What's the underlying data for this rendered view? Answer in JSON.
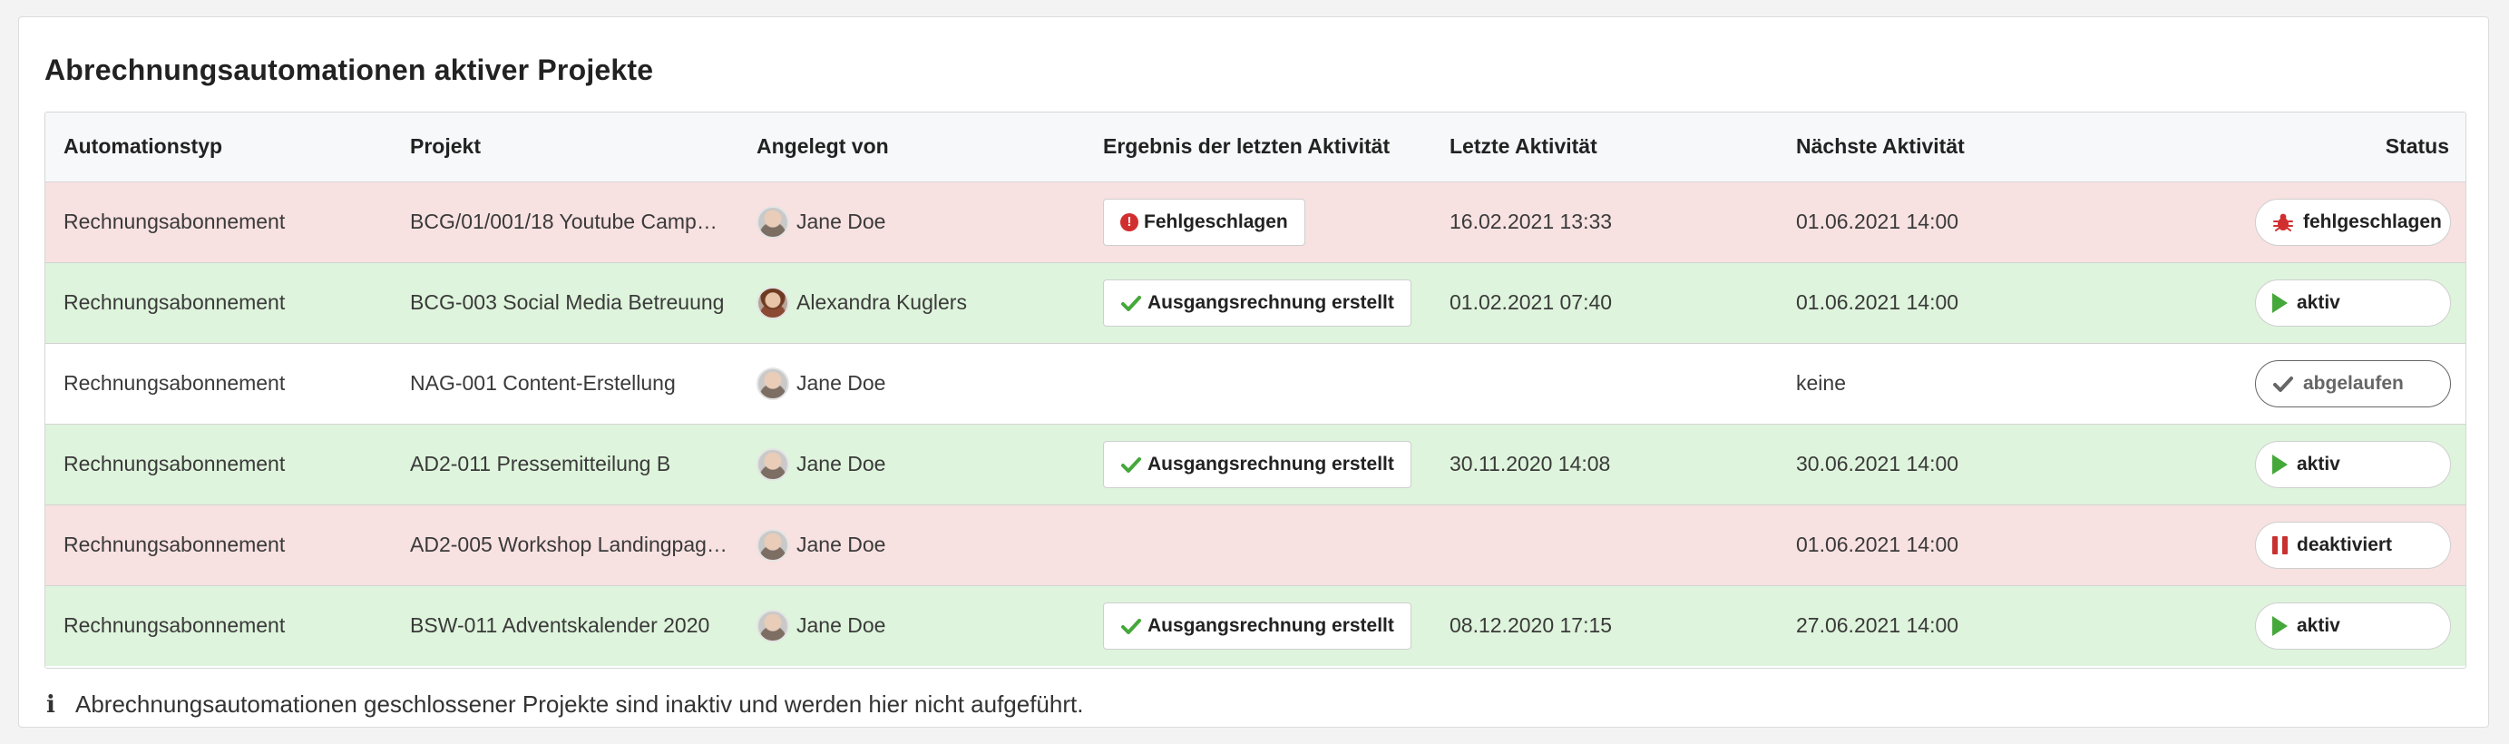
{
  "panel": {
    "title": "Abrechnungsautomationen aktiver Projekte",
    "footer_note": "Abrechnungsautomationen geschlossener Projekte sind inaktiv und werden hier nicht aufgeführt.",
    "footer_icon": "info-icon"
  },
  "table": {
    "headers": {
      "type": "Automationstyp",
      "project": "Projekt",
      "creator": "Angelegt von",
      "result": "Ergebnis der letzten Aktivität",
      "last": "Letzte Aktivität",
      "next": "Nächste Aktivität",
      "status": "Status"
    },
    "rows": [
      {
        "tone": "red",
        "type": "Rechnungsabonnement",
        "project": "BCG/01/001/18 Youtube Camp…",
        "creator": "Jane Doe",
        "result": "Fehlgeschlagen",
        "result_icon": "error-icon",
        "last": "16.02.2021 13:33",
        "next": "01.06.2021 14:00",
        "status": "fehlgeschlagen",
        "status_icon": "bug-icon"
      },
      {
        "tone": "green",
        "type": "Rechnungsabonnement",
        "project": "BCG-003 Social Media Betreuung",
        "creator": "Alexandra Kuglers",
        "result": "Ausgangsrechnung erstellt",
        "result_icon": "check-icon",
        "last": "01.02.2021 07:40",
        "next": "01.06.2021 14:00",
        "status": "aktiv",
        "status_icon": "play-icon"
      },
      {
        "tone": "white",
        "type": "Rechnungsabonnement",
        "project": "NAG-001 Content-Erstellung",
        "creator": "Jane Doe",
        "result": "",
        "result_icon": "",
        "last": "",
        "next": "keine",
        "status": "abgelaufen",
        "status_icon": "check-icon"
      },
      {
        "tone": "green",
        "type": "Rechnungsabonnement",
        "project": "AD2-011 Pressemitteilung B",
        "creator": "Jane Doe",
        "result": "Ausgangsrechnung erstellt",
        "result_icon": "check-icon",
        "last": "30.11.2020 14:08",
        "next": "30.06.2021 14:00",
        "status": "aktiv",
        "status_icon": "play-icon"
      },
      {
        "tone": "red",
        "type": "Rechnungsabonnement",
        "project": "AD2-005 Workshop Landingpag…",
        "creator": "Jane Doe",
        "result": "",
        "result_icon": "",
        "last": "",
        "next": "01.06.2021 14:00",
        "status": "deaktiviert",
        "status_icon": "pause-icon"
      },
      {
        "tone": "green",
        "type": "Rechnungsabonnement",
        "project": "BSW-011 Adventskalender 2020",
        "creator": "Jane Doe",
        "result": "Ausgangsrechnung erstellt",
        "result_icon": "check-icon",
        "last": "08.12.2020 17:15",
        "next": "27.06.2021 14:00",
        "status": "aktiv",
        "status_icon": "play-icon"
      }
    ]
  },
  "colors": {
    "row_red": "#f8e1e1",
    "row_green": "#def4dc",
    "row_white": "#ffffff",
    "check": "#45a83a",
    "error": "#d12f2f",
    "expired": "#666666"
  }
}
